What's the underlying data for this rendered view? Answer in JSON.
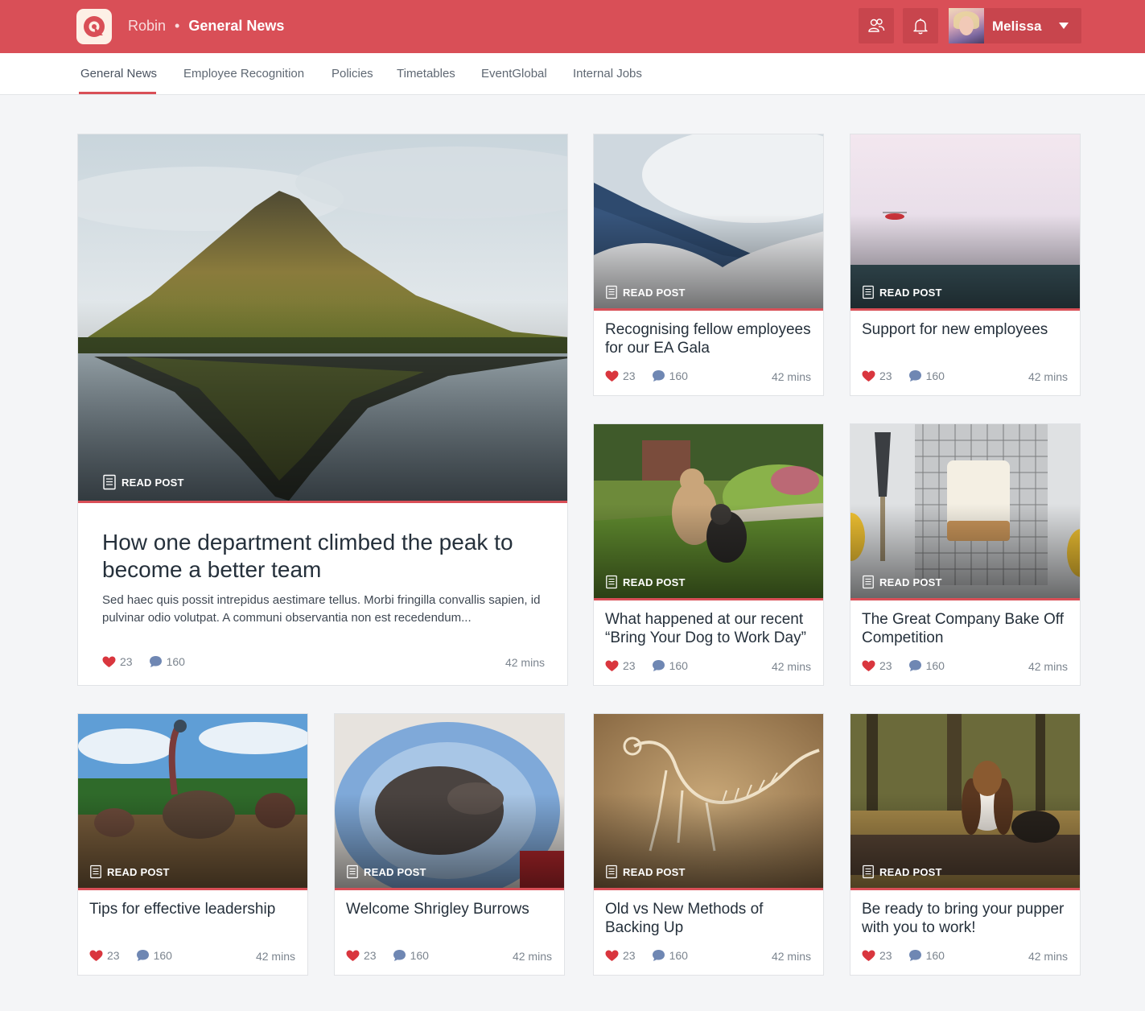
{
  "header": {
    "brand": "Robin",
    "separator": "•",
    "section": "General News",
    "user_name": "Melissa",
    "icons": [
      "people-icon",
      "bell-icon"
    ]
  },
  "tabs": [
    {
      "label": "General News",
      "active": true
    },
    {
      "label": "Employee Recognition",
      "active": false
    },
    {
      "label": "Policies",
      "active": false
    },
    {
      "label": "Timetables",
      "active": false
    },
    {
      "label": "EventGlobal",
      "active": false
    },
    {
      "label": "Internal Jobs",
      "active": false
    }
  ],
  "read_post_label": "READ POST",
  "featured": {
    "title": "How one department climbed the peak to become a better team",
    "excerpt": "Sed haec quis possit intrepidus aestimare tellus. Morbi fringilla convallis sapien, id pulvinar odio volutpat. A communi observantia non est recedendum...",
    "likes": "23",
    "comments": "160",
    "time": "42 mins"
  },
  "posts": [
    {
      "title": "Recognising fellow employees for our EA Gala",
      "likes": "23",
      "comments": "160",
      "time": "42 mins"
    },
    {
      "title": "Support for new employees",
      "likes": "23",
      "comments": "160",
      "time": "42 mins"
    },
    {
      "title": "What happened at our recent “Bring Your Dog to Work Day”",
      "likes": "23",
      "comments": "160",
      "time": "42 mins"
    },
    {
      "title": "The Great Company Bake Off Competition",
      "likes": "23",
      "comments": "160",
      "time": "42 mins"
    },
    {
      "title": "Tips for effective leadership",
      "likes": "23",
      "comments": "160",
      "time": "42 mins"
    },
    {
      "title": "Welcome Shrigley Burrows",
      "likes": "23",
      "comments": "160",
      "time": "42 mins"
    },
    {
      "title": "Old vs New Methods of Backing Up",
      "likes": "23",
      "comments": "160",
      "time": "42 mins"
    },
    {
      "title": "Be ready to bring your pupper with you to work!",
      "likes": "23",
      "comments": "160",
      "time": "42 mins"
    }
  ],
  "colors": {
    "brand": "#d94f57",
    "like": "#d9363e",
    "comment": "#6f87b3"
  }
}
